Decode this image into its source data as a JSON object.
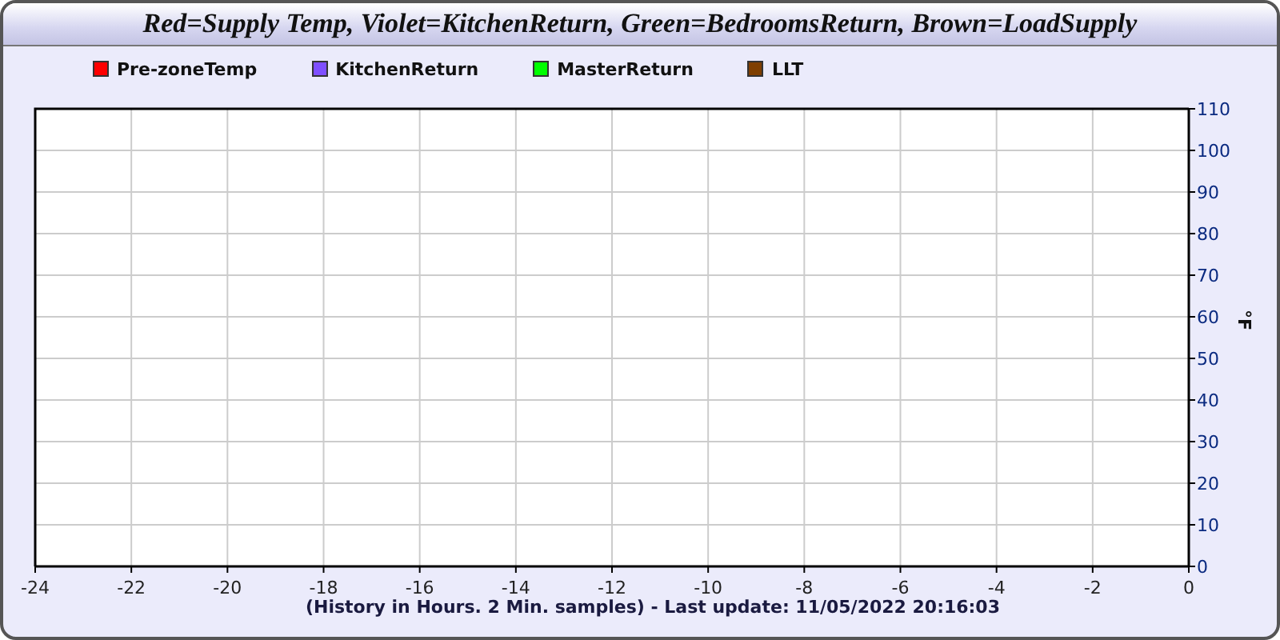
{
  "title": "Red=Supply Temp, Violet=KitchenReturn, Green=BedroomsReturn, Brown=LoadSupply",
  "chart_data": {
    "type": "line",
    "xlabel": "(History in Hours. 2 Min. samples) - Last update: 11/05/2022 20:16:03",
    "ylabel": "°F",
    "series": [
      {
        "name": "Pre-zoneTemp",
        "color": "#ff0000",
        "values": [
          null,
          null,
          null,
          null,
          null,
          null,
          null,
          null,
          null,
          null,
          null,
          null,
          null
        ]
      },
      {
        "name": "KitchenReturn",
        "color": "#7f4fff",
        "values": [
          null,
          null,
          null,
          null,
          null,
          null,
          null,
          null,
          null,
          null,
          null,
          null,
          null
        ]
      },
      {
        "name": "MasterReturn",
        "color": "#00ff00",
        "values": [
          null,
          null,
          null,
          null,
          null,
          null,
          null,
          null,
          null,
          null,
          null,
          null,
          null
        ]
      },
      {
        "name": "LLT",
        "color": "#7f3f00",
        "values": [
          null,
          null,
          null,
          null,
          null,
          null,
          null,
          null,
          null,
          null,
          null,
          null,
          null
        ]
      }
    ],
    "categories": [
      "-24",
      "-22",
      "-20",
      "-18",
      "-16",
      "-14",
      "-12",
      "-10",
      "-8",
      "-6",
      "-4",
      "-2",
      "0"
    ],
    "grid": true,
    "ylim": [
      0,
      110
    ],
    "yticks": [
      0,
      10,
      20,
      30,
      40,
      50,
      60,
      70,
      80,
      90,
      100,
      110
    ]
  }
}
